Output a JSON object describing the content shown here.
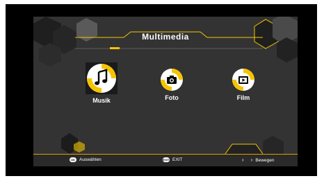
{
  "header": {
    "title": "Multimedia"
  },
  "menu": {
    "items": [
      {
        "label": "Musik",
        "icon": "music-note-icon",
        "selected": true
      },
      {
        "label": "Foto",
        "icon": "camera-icon",
        "selected": false
      },
      {
        "label": "Film",
        "icon": "film-play-icon",
        "selected": false
      }
    ]
  },
  "footer": {
    "ok_key": "OK",
    "ok_label": "Auswählen",
    "exit_key": "EXIT",
    "exit_label": "EXIT",
    "move_label": "Bewegen"
  },
  "colors": {
    "accent": "#f5c400",
    "panel": "#333333",
    "dark": "#000000"
  }
}
